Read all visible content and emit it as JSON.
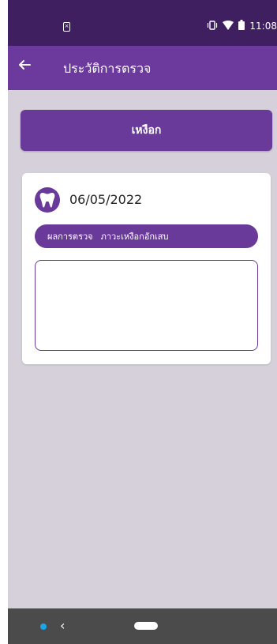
{
  "status_bar": {
    "time": "11:08"
  },
  "app_bar": {
    "title": "ประวัติการตรวจ"
  },
  "category_button": {
    "label": "เหงือก"
  },
  "record": {
    "date": "06/05/2022",
    "result_label": "ผลการตรวจ",
    "result_value": "ภาวะเหงือกอักเสบ",
    "notes_value": ""
  },
  "colors": {
    "status_bar_bg": "#3f1f5f",
    "app_bar_bg": "#6b3a9c",
    "accent": "#6a3a9a",
    "page_bg": "#d6d0da"
  },
  "icons": {
    "back": "arrow-left-icon",
    "tooth": "tooth-icon",
    "sim": "sim-card-icon",
    "vibrate": "vibrate-icon",
    "wifi": "wifi-icon",
    "battery": "battery-icon"
  }
}
